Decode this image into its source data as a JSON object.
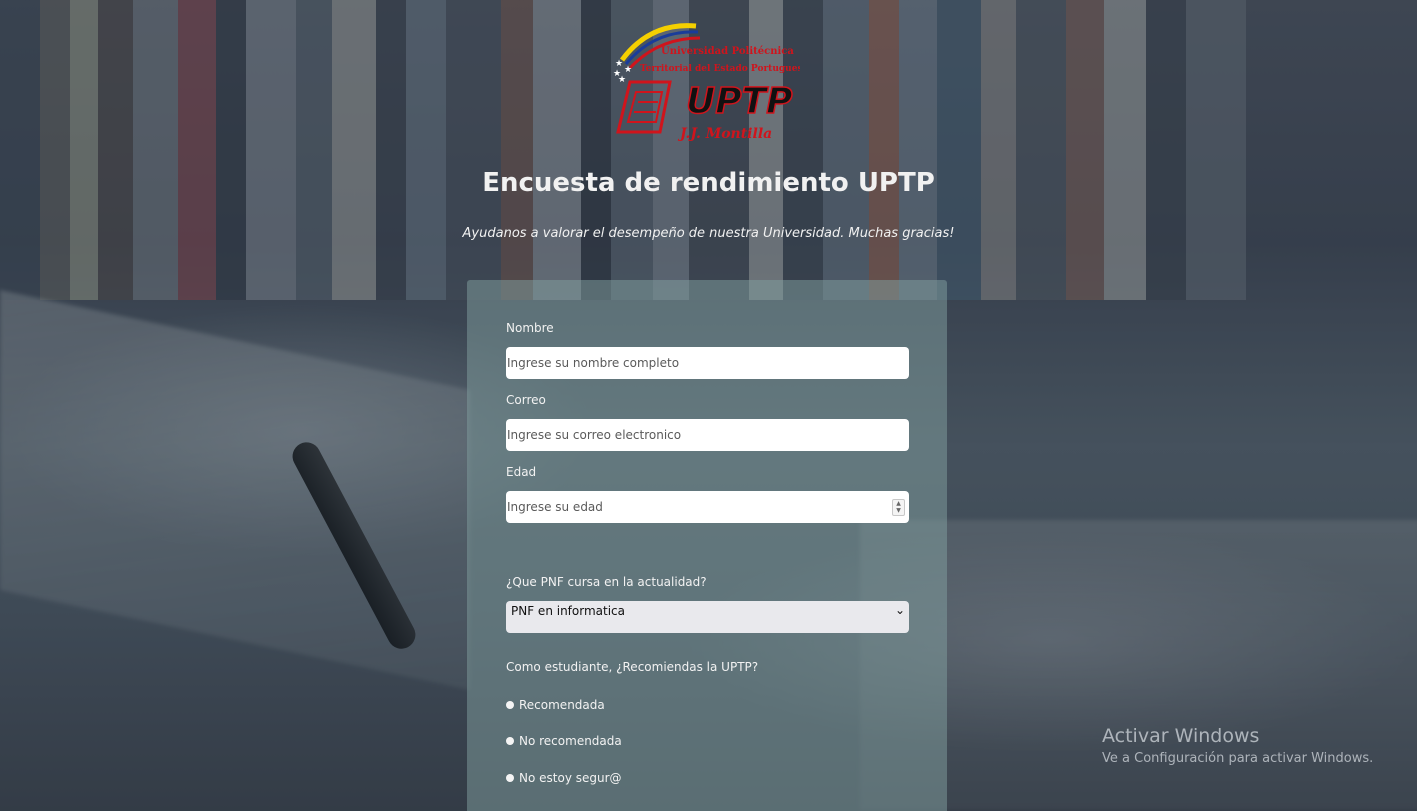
{
  "logo": {
    "line1": "Universidad Politécnica",
    "line2": "Territorial del Estado Portuguesa",
    "acronym": "UPTP",
    "campus": "J.J. Montilla",
    "colors": {
      "red": "#d0141c",
      "yellow": "#f5d000",
      "blue": "#1a3c9a",
      "black": "#111111"
    }
  },
  "header": {
    "title": "Encuesta de rendimiento UPTP",
    "subtitle": "Ayudanos a valorar el desempeño de nuestra Universidad. Muchas gracias!"
  },
  "form": {
    "name": {
      "label": "Nombre",
      "placeholder": "Ingrese su nombre completo"
    },
    "email": {
      "label": "Correo",
      "placeholder": "Ingrese su correo electronico"
    },
    "age": {
      "label": "Edad",
      "placeholder": "Ingrese su edad"
    },
    "pnf": {
      "label": "¿Que PNF cursa en la actualidad?",
      "selected": "PNF en informatica"
    },
    "recommend": {
      "label": "Como estudiante, ¿Recomiendas la UPTP?",
      "options": [
        "Recomendada",
        "No recomendada",
        "No estoy segur@"
      ]
    }
  },
  "watermark": {
    "line1": "Activar Windows",
    "line2": "Ve a Configuración para activar Windows."
  }
}
